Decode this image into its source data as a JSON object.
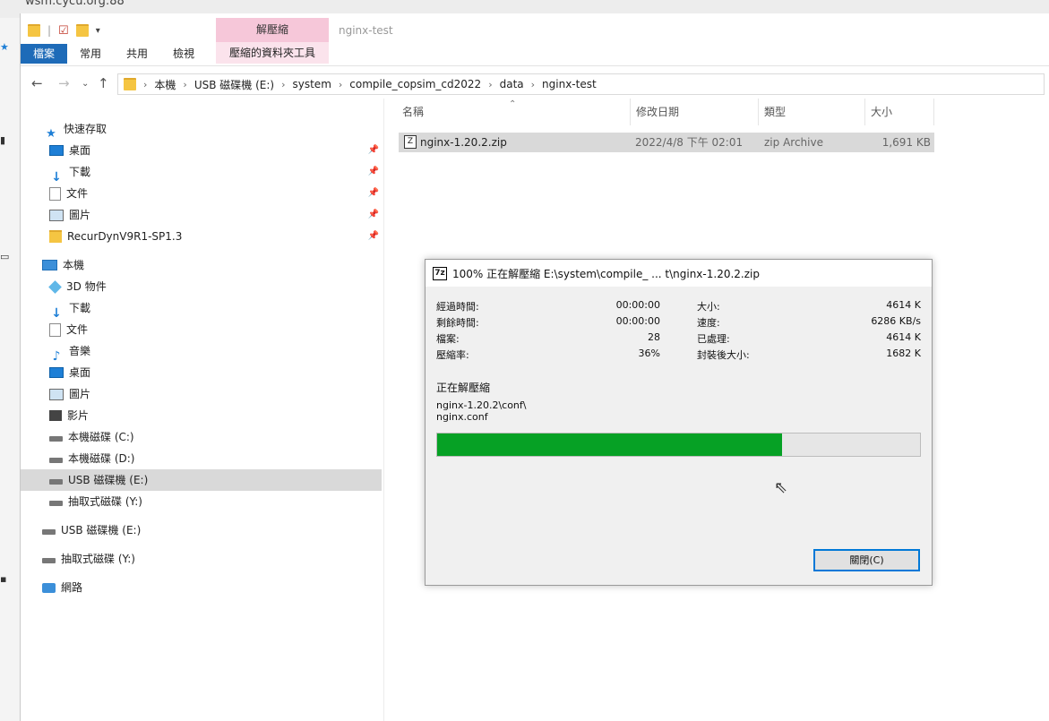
{
  "background_window": {
    "title": "wsm.cycu.org:88"
  },
  "window": {
    "title": "nginx-test"
  },
  "ribbon": {
    "tabs": [
      "檔案",
      "常用",
      "共用",
      "檢視"
    ],
    "context_group_title": "解壓縮",
    "context_tab": "壓縮的資料夾工具"
  },
  "address": {
    "breadcrumbs": [
      "本機",
      "USB 磁碟機 (E:)",
      "system",
      "compile_copsim_cd2022",
      "data",
      "nginx-test"
    ]
  },
  "nav": {
    "quick_access_label": "快速存取",
    "quick_access": [
      {
        "label": "桌面",
        "icon": "desktop-icon",
        "pinned": true
      },
      {
        "label": "下載",
        "icon": "download-icon",
        "pinned": true
      },
      {
        "label": "文件",
        "icon": "document-icon",
        "pinned": true
      },
      {
        "label": "圖片",
        "icon": "pictures-icon",
        "pinned": true
      },
      {
        "label": "RecurDynV9R1-SP1.3",
        "icon": "folder-icon",
        "pinned": true
      }
    ],
    "this_pc_label": "本機",
    "this_pc": [
      {
        "label": "3D 物件",
        "icon": "3d-objects-icon"
      },
      {
        "label": "下載",
        "icon": "download-icon"
      },
      {
        "label": "文件",
        "icon": "document-icon"
      },
      {
        "label": "音樂",
        "icon": "music-icon"
      },
      {
        "label": "桌面",
        "icon": "desktop-icon"
      },
      {
        "label": "圖片",
        "icon": "pictures-icon"
      },
      {
        "label": "影片",
        "icon": "video-icon"
      },
      {
        "label": "本機磁碟 (C:)",
        "icon": "drive-icon"
      },
      {
        "label": "本機磁碟 (D:)",
        "icon": "drive-icon"
      },
      {
        "label": "USB 磁碟機 (E:)",
        "icon": "drive-icon",
        "selected": true
      },
      {
        "label": "抽取式磁碟 (Y:)",
        "icon": "drive-icon"
      }
    ],
    "usb_label": "USB 磁碟機 (E:)",
    "removable_label": "抽取式磁碟 (Y:)",
    "network_label": "網路"
  },
  "files": {
    "columns": [
      "名稱",
      "修改日期",
      "類型",
      "大小"
    ],
    "rows": [
      {
        "name": "nginx-1.20.2.zip",
        "date": "2022/4/8 下午 02:01",
        "type": "zip Archive",
        "size": "1,691 KB"
      }
    ]
  },
  "dialog": {
    "icon_text": "7z",
    "title": "100% 正在解壓縮 E:\\system\\compile_ ... t\\nginx-1.20.2.zip",
    "stats_left": [
      {
        "label": "經過時間:",
        "value": "00:00:00"
      },
      {
        "label": "剩餘時間:",
        "value": "00:00:00"
      },
      {
        "label": "檔案:",
        "value": "28"
      },
      {
        "label": "壓縮率:",
        "value": "36%"
      }
    ],
    "stats_right": [
      {
        "label": "大小:",
        "value": "4614 K"
      },
      {
        "label": "速度:",
        "value": "6286 KB/s"
      },
      {
        "label": "已處理:",
        "value": "4614 K"
      },
      {
        "label": "封裝後大小:",
        "value": "1682 K"
      }
    ],
    "status_label": "正在解壓縮",
    "current_path": "nginx-1.20.2\\conf\\",
    "current_file": "nginx.conf",
    "progress_fraction": 0.715,
    "progress_color": "#06a125",
    "close_button": "關閉(C)"
  }
}
